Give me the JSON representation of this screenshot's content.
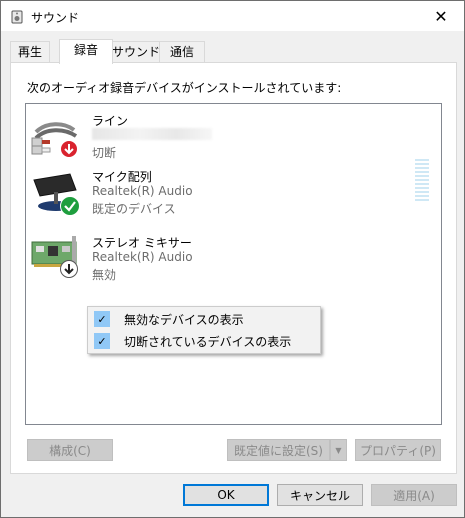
{
  "window": {
    "title": "サウンド",
    "close_glyph": "✕"
  },
  "tabs": [
    {
      "label": "再生"
    },
    {
      "label": "録音"
    },
    {
      "label": "サウンド"
    },
    {
      "label": "通信"
    }
  ],
  "panel": {
    "intro": "次のオーディオ録音デバイスがインストールされています:"
  },
  "devices": [
    {
      "name": "ライン",
      "line1": "",
      "status": "切断",
      "icon": "line-in-cable-icon",
      "badge": "disconnected-down-arrow-icon"
    },
    {
      "name": "マイク配列",
      "line1": "Realtek(R) Audio",
      "status": "既定のデバイス",
      "icon": "microphone-array-icon",
      "badge": "default-check-icon"
    },
    {
      "name": "ステレオ ミキサー",
      "line1": "Realtek(R) Audio",
      "status": "無効",
      "icon": "sound-card-icon",
      "badge": "disabled-down-arrow-icon"
    }
  ],
  "context_menu": {
    "items": [
      {
        "label": "無効なデバイスの表示",
        "checked": true
      },
      {
        "label": "切断されているデバイスの表示",
        "checked": true
      }
    ]
  },
  "panel_buttons": {
    "configure": "構成(C)",
    "set_default": "既定値に設定(S)",
    "properties": "プロパティ(P)"
  },
  "dialog_buttons": {
    "ok": "OK",
    "cancel": "キャンセル",
    "apply": "適用(A)"
  },
  "colors": {
    "accent": "#0078d7",
    "check_highlight": "#90c8f6",
    "badge_green": "#1e9e3e",
    "badge_red": "#d9232e"
  }
}
